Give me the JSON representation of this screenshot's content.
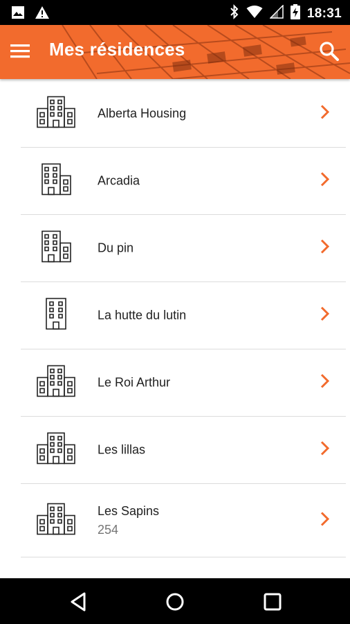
{
  "status_bar": {
    "time": "18:31",
    "icons": [
      "image-icon",
      "warning-icon",
      "bluetooth-icon",
      "wifi-icon",
      "signal-icon",
      "battery-charging-icon"
    ]
  },
  "app_bar": {
    "title": "Mes résidences",
    "menu_icon": "menu-icon",
    "search_icon": "search-icon",
    "accent_color": "#f26b2d"
  },
  "residences": [
    {
      "name": "Alberta Housing",
      "sub": "",
      "icon": "apartment-complex-icon"
    },
    {
      "name": "Arcadia",
      "sub": "",
      "icon": "apartment-building-icon"
    },
    {
      "name": "Du pin",
      "sub": "",
      "icon": "apartment-building-icon"
    },
    {
      "name": "La hutte du lutin",
      "sub": "",
      "icon": "tower-building-icon"
    },
    {
      "name": "Le Roi Arthur",
      "sub": "",
      "icon": "apartment-complex-icon"
    },
    {
      "name": "Les lillas",
      "sub": "",
      "icon": "apartment-complex-icon"
    },
    {
      "name": "Les Sapins",
      "sub": "254",
      "icon": "apartment-complex-icon"
    }
  ],
  "nav_bar": {
    "icons": [
      "back-icon",
      "home-icon",
      "recents-icon"
    ]
  }
}
